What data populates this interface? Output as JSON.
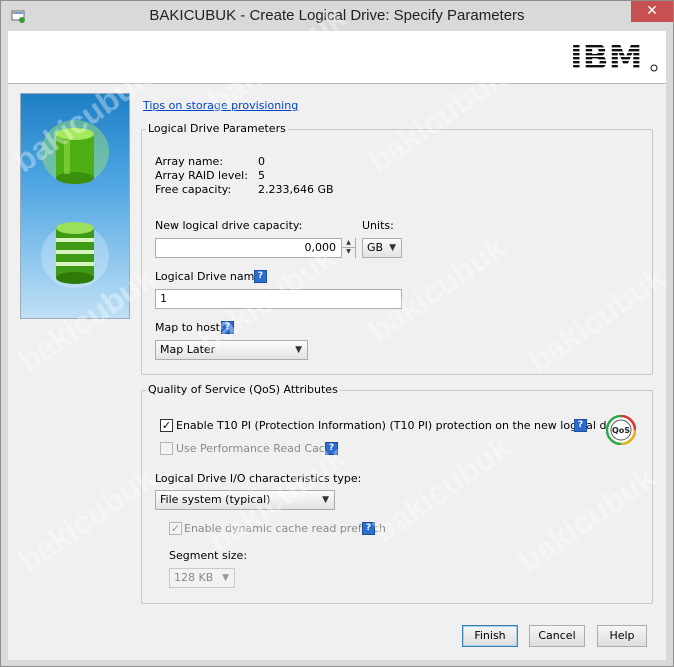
{
  "window": {
    "title": "BAKICUBUK - Create Logical Drive: Specify Parameters",
    "close_glyph": "✕"
  },
  "banner": {
    "logo": "IBM"
  },
  "tips_link": "Tips on storage provisioning",
  "params": {
    "legend": "Logical Drive Parameters",
    "array_name_label": "Array name:",
    "array_name_value": "0",
    "raid_label": "Array RAID level:",
    "raid_value": "5",
    "free_label": "Free capacity:",
    "free_value": "2.233,646 GB",
    "capacity_label": "New logical drive capacity:",
    "capacity_value": "0,000",
    "units_label": "Units:",
    "units_value": "GB",
    "name_label": "Logical Drive name:",
    "name_value": "1",
    "map_label": "Map to host:",
    "map_value": "Map Later"
  },
  "qos": {
    "legend": "Quality of Service (QoS) Attributes",
    "t10_label": "Enable T10 PI (Protection Information) (T10 PI) protection on the new logical drive",
    "t10_checked": true,
    "perf_label": "Use Performance Read Cache",
    "perf_checked": false,
    "io_label": "Logical Drive I/O characteristics type:",
    "io_value": "File system (typical)",
    "prefetch_label": "Enable dynamic cache read prefetch",
    "prefetch_checked": true,
    "segment_label": "Segment size:",
    "segment_value": "128 KB",
    "badge_text": "QoS"
  },
  "buttons": {
    "finish": "Finish",
    "cancel": "Cancel",
    "help": "Help"
  },
  "help_glyph": "?",
  "check_glyph": "✓",
  "watermark": "bakicubuk",
  "colors": {
    "accent_blue": "#2c6ecf",
    "close_red": "#c75050",
    "drive_green": "#5fbf1f"
  }
}
